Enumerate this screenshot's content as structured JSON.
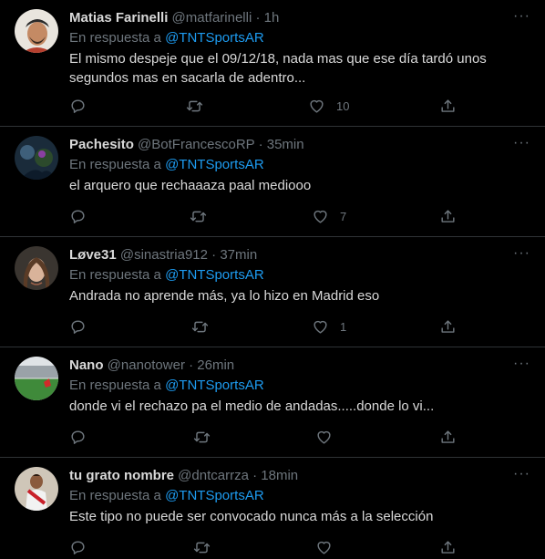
{
  "reply_prefix": "En respuesta a",
  "more_glyph": "···",
  "tweets": [
    {
      "name": "Matias Farinelli",
      "handle": "@matfarinelli",
      "sep": "·",
      "time": "1h",
      "mention": "@TNTSportsAR",
      "text": "El mismo despeje que el 09/12/18, nada mas que ese día tardó unos segundos mas en sacarla de adentro...",
      "likes": "10",
      "avatar": "person-wearing-cap"
    },
    {
      "name": "Pachesito",
      "handle": "@BotFrancescoRP",
      "sep": "·",
      "time": "35min",
      "mention": "@TNTSportsAR",
      "text": "el arquero que rechaaaza paal mediooo",
      "likes": "7",
      "avatar": "dark-photo"
    },
    {
      "name": "Løve31",
      "handle": "@sinastria912",
      "sep": "·",
      "time": "37min",
      "mention": "@TNTSportsAR",
      "text": "Andrada no aprende más, ya lo hizo en Madrid eso",
      "likes": "1",
      "avatar": "woman-portrait"
    },
    {
      "name": "Nano",
      "handle": "@nanotower",
      "sep": "·",
      "time": "26min",
      "mention": "@TNTSportsAR",
      "text": "donde vi el rechazo pa el medio de andadas.....donde lo vi...",
      "likes": "",
      "avatar": "stadium-photo"
    },
    {
      "name": "tu grato nombre",
      "handle": "@dntcarrza",
      "sep": "·",
      "time": "18min",
      "mention": "@TNTSportsAR",
      "text": "Este tipo no puede ser convocado nunca más a la selección",
      "likes": "",
      "avatar": "footballer-photo"
    }
  ],
  "colors": {
    "background": "#000000",
    "divider": "#2f3336",
    "muted": "#6e767d",
    "mention": "#1d9bf0",
    "text": "#d9d9d9"
  }
}
